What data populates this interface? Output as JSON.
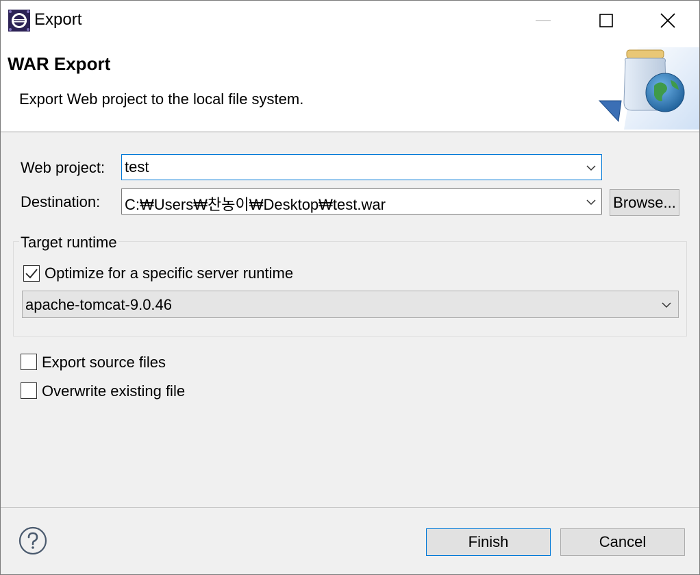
{
  "window": {
    "title": "Export",
    "controls": {
      "minimize": "minimize",
      "maximize": "maximize",
      "close": "close"
    }
  },
  "banner": {
    "title": "WAR Export",
    "description": "Export Web project to the local file system."
  },
  "form": {
    "web_project_label": "Web project:",
    "web_project_value": "test",
    "destination_label": "Destination:",
    "destination_value": "C:₩Users₩찬농이₩Desktop₩test.war",
    "browse_label": "Browse..."
  },
  "target_runtime": {
    "group_label": "Target runtime",
    "optimize_label": "Optimize for a specific server runtime",
    "optimize_checked": true,
    "runtime_value": "apache-tomcat-9.0.46"
  },
  "options": {
    "export_source_label": "Export source files",
    "export_source_checked": false,
    "overwrite_label": "Overwrite existing file",
    "overwrite_checked": false
  },
  "footer": {
    "finish_label": "Finish",
    "cancel_label": "Cancel",
    "help_icon": "help-icon"
  },
  "colors": {
    "focus_border": "#0078d7",
    "button_face": "#e1e1e1",
    "dialog_background": "#f0f0f0"
  }
}
